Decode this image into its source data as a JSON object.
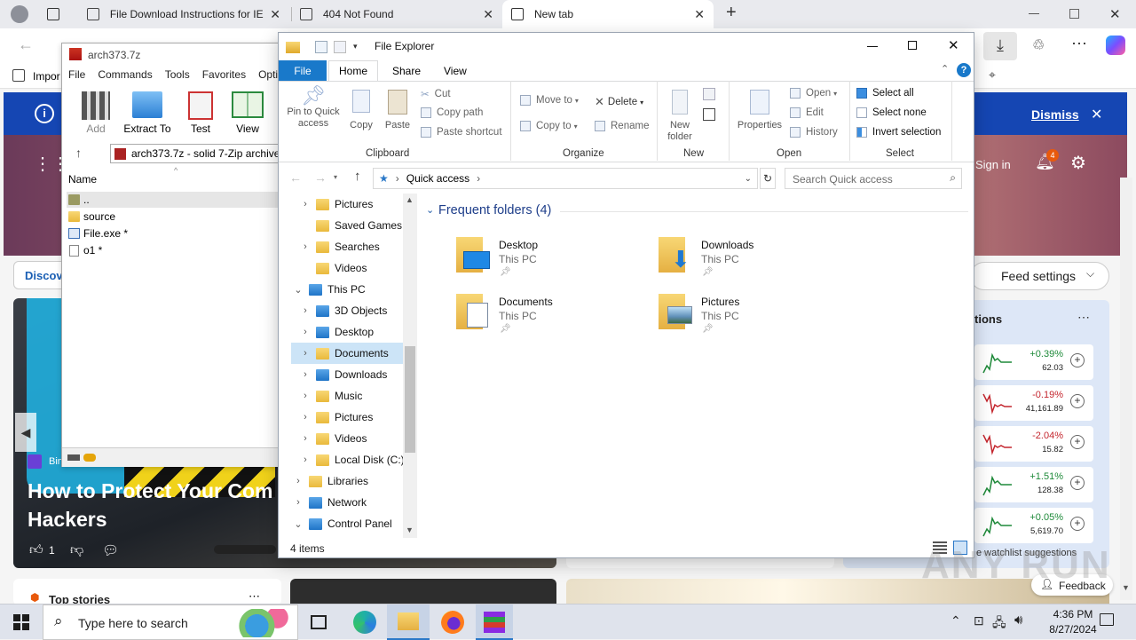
{
  "browser": {
    "tabs": [
      {
        "title": "File Download Instructions for IE",
        "active": false
      },
      {
        "title": "404 Not Found",
        "active": false
      },
      {
        "title": "New tab",
        "active": true
      }
    ],
    "new_tab_symbol": "+",
    "favorites_item": "Impor",
    "dismiss_label": "Dismiss"
  },
  "msn": {
    "sign_in": "Sign in",
    "notification_count": "4",
    "discover_label": "Discov",
    "feed_settings": "Feed settings",
    "watchlist_title": "tions",
    "headline": "How to Protect Your Com Hackers",
    "headline_line1": "How to Protect Your Com",
    "headline_line2": "Hackers",
    "source": "Bing",
    "likes": "1",
    "top_stories": "Top stories",
    "watchlist_suggestions": "e watchlist suggestions",
    "feedback": "Feedback",
    "stocks": [
      {
        "change": "+0.39%",
        "value": "62.03",
        "color": "#1f8a3a"
      },
      {
        "change": "-0.19%",
        "value": "41,161.89",
        "color": "#c4262e"
      },
      {
        "change": "-2.04%",
        "value": "15.82",
        "color": "#c4262e"
      },
      {
        "change": "+1.51%",
        "value": "128.38",
        "color": "#1f8a3a"
      },
      {
        "change": "+0.05%",
        "value": "5,619.70",
        "color": "#1f8a3a"
      }
    ]
  },
  "sevenzip": {
    "title": "arch373.7z",
    "menu": [
      "File",
      "Commands",
      "Tools",
      "Favorites",
      "Optio"
    ],
    "toolbar": [
      "Add",
      "Extract To",
      "Test",
      "View"
    ],
    "path": "arch373.7z - solid 7-Zip archive,",
    "column_name": "Name",
    "files": [
      "..",
      "source",
      "File.exe *",
      "o1 *"
    ]
  },
  "explorer": {
    "title": "File Explorer",
    "ribbon_tabs": [
      "File",
      "Home",
      "Share",
      "View"
    ],
    "clipboard": {
      "pin": "Pin to Quick access",
      "pin_line1": "Pin to Quick",
      "pin_line2": "access",
      "copy": "Copy",
      "paste": "Paste",
      "cut": "Cut",
      "copy_path": "Copy path",
      "paste_shortcut": "Paste shortcut",
      "label": "Clipboard"
    },
    "organize": {
      "move_to": "Move to",
      "copy_to": "Copy to",
      "delete": "Delete",
      "rename": "Rename",
      "label": "Organize"
    },
    "new": {
      "new_folder_line1": "New",
      "new_folder_line2": "folder",
      "label": "New"
    },
    "open": {
      "properties": "Properties",
      "open": "Open",
      "edit": "Edit",
      "history": "History",
      "label": "Open"
    },
    "select": {
      "select_all": "Select all",
      "select_none": "Select none",
      "invert": "Invert selection",
      "label": "Select"
    },
    "address": "Quick access",
    "search_placeholder": "Search Quick access",
    "section_title": "Frequent folders (4)",
    "tiles": [
      {
        "name": "Desktop",
        "location": "This PC"
      },
      {
        "name": "Downloads",
        "location": "This PC"
      },
      {
        "name": "Documents",
        "location": "This PC"
      },
      {
        "name": "Pictures",
        "location": "This PC"
      }
    ],
    "tree": [
      {
        "label": "Pictures",
        "chev": "›",
        "indent": 1
      },
      {
        "label": "Saved Games",
        "chev": "",
        "indent": 1
      },
      {
        "label": "Searches",
        "chev": "›",
        "indent": 1
      },
      {
        "label": "Videos",
        "chev": "",
        "indent": 1
      },
      {
        "label": "This PC",
        "chev": "⌄",
        "indent": 0
      },
      {
        "label": "3D Objects",
        "chev": "›",
        "indent": 1
      },
      {
        "label": "Desktop",
        "chev": "›",
        "indent": 1
      },
      {
        "label": "Documents",
        "chev": "›",
        "indent": 1,
        "selected": true
      },
      {
        "label": "Downloads",
        "chev": "›",
        "indent": 1
      },
      {
        "label": "Music",
        "chev": "›",
        "indent": 1
      },
      {
        "label": "Pictures",
        "chev": "›",
        "indent": 1
      },
      {
        "label": "Videos",
        "chev": "›",
        "indent": 1
      },
      {
        "label": "Local Disk (C:)",
        "chev": "›",
        "indent": 1
      },
      {
        "label": "Libraries",
        "chev": "›",
        "indent": 0
      },
      {
        "label": "Network",
        "chev": "›",
        "indent": 0
      },
      {
        "label": "Control Panel",
        "chev": "⌄",
        "indent": 0
      }
    ],
    "status": "4 items"
  },
  "taskbar": {
    "search_placeholder": "Type here to search",
    "time": "4:36 PM",
    "date": "8/27/2024"
  },
  "watermark": "ANY RUN"
}
